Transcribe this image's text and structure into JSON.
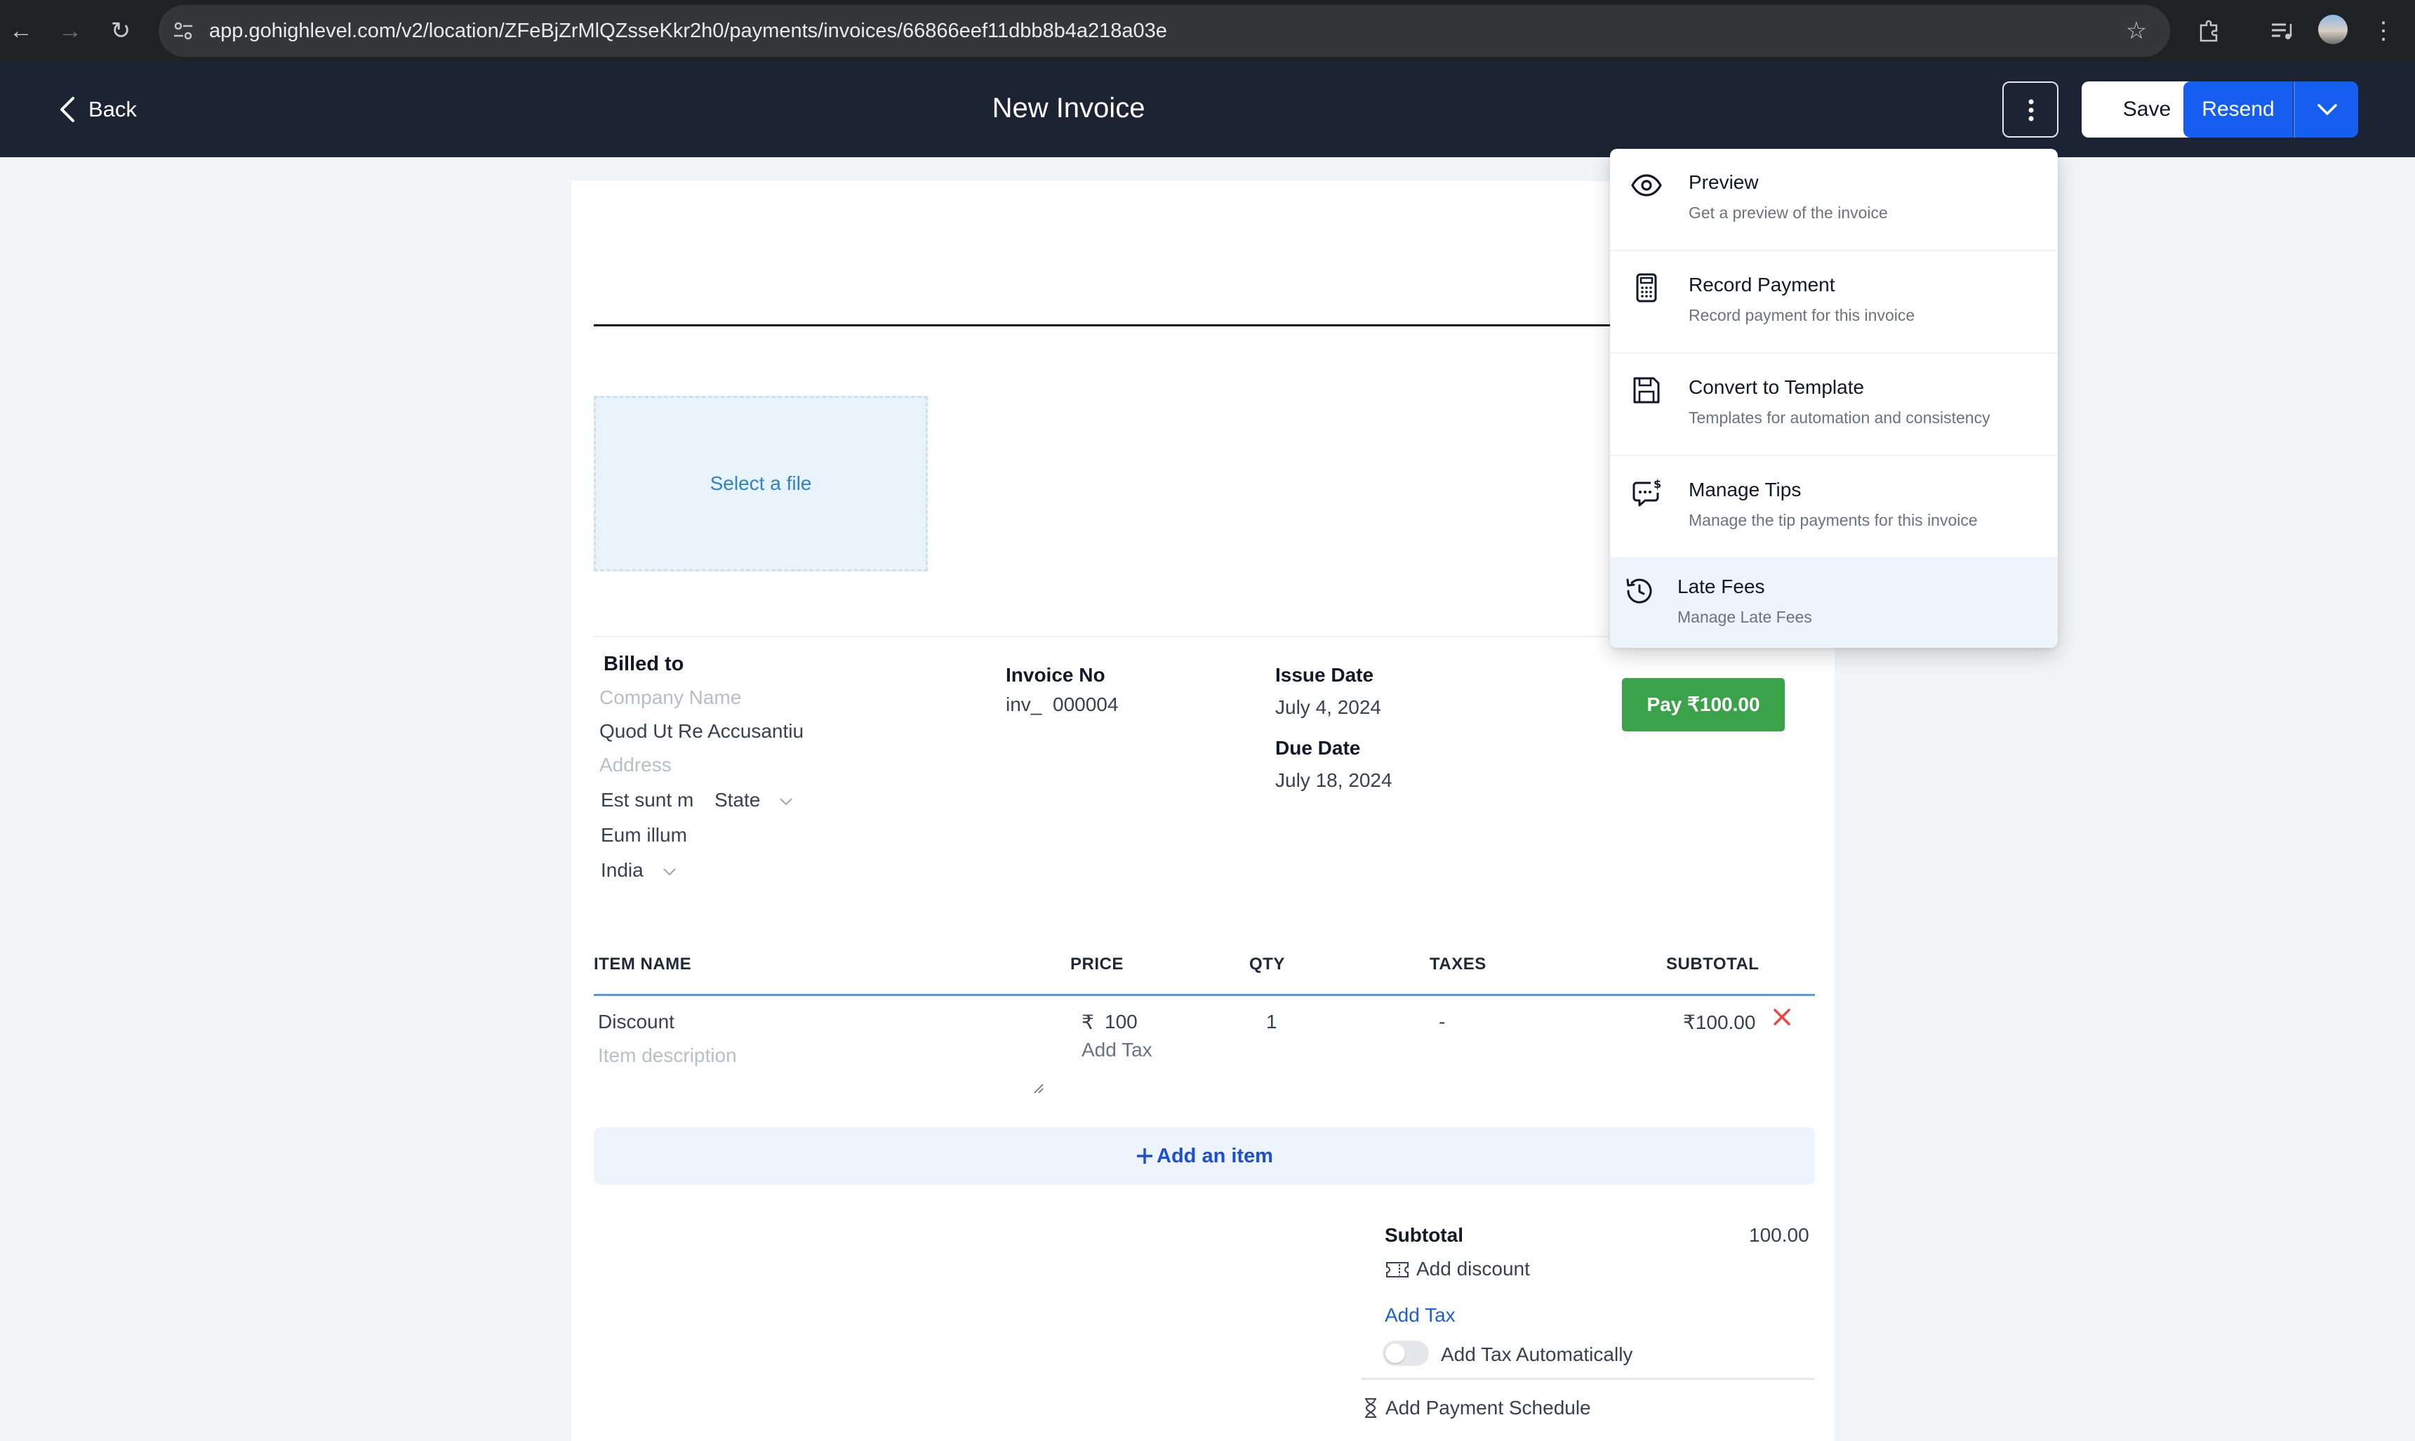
{
  "browser": {
    "url": "app.gohighlevel.com/v2/location/ZFeBjZrMlQZsseKkr2h0/payments/invoices/66866eef11dbb8b4a218a03e"
  },
  "header": {
    "back_label": "Back",
    "title": "New Invoice",
    "save_label": "Save",
    "resend_label": "Resend"
  },
  "menu": {
    "items": [
      {
        "icon": "eye-icon",
        "title": "Preview",
        "subtitle": "Get a preview of the invoice"
      },
      {
        "icon": "calculator-icon",
        "title": "Record Payment",
        "subtitle": "Record payment for this invoice"
      },
      {
        "icon": "floppy-disk-icon",
        "title": "Convert to Template",
        "subtitle": "Templates for automation and consistency"
      },
      {
        "icon": "tips-icon",
        "title": "Manage Tips",
        "subtitle": "Manage the tip payments for this invoice"
      },
      {
        "icon": "clock-history-icon",
        "title": "Late Fees",
        "subtitle": "Manage Late Fees"
      }
    ]
  },
  "logo_upload": {
    "label": "Select a file"
  },
  "billed_to": {
    "heading": "Billed to",
    "company_placeholder": "Company Name",
    "name": "Quod Ut Re Accusantiu",
    "address_placeholder": "Address",
    "city": "Est sunt m",
    "state": "State",
    "zip": "Eum illum",
    "country": "India"
  },
  "invoice": {
    "number_label": "Invoice No",
    "prefix": "inv_",
    "number": "000004",
    "issue_date_label": "Issue Date",
    "issue_date": "July 4, 2024",
    "due_date_label": "Due Date",
    "due_date": "July 18, 2024",
    "pay_button": "Pay ₹100.00"
  },
  "items_table": {
    "headers": [
      "ITEM NAME",
      "PRICE",
      "QTY",
      "TAXES",
      "SUBTOTAL"
    ],
    "rows": [
      {
        "name": "Discount",
        "description_placeholder": "Item description",
        "currency": "₹",
        "price": "100",
        "add_tax": "Add Tax",
        "qty": "1",
        "taxes": "-",
        "subtotal": "₹100.00"
      }
    ],
    "add_item": "Add an item"
  },
  "summary": {
    "subtotal_label": "Subtotal",
    "subtotal_value": "100.00",
    "add_discount": "Add discount",
    "add_tax": "Add Tax",
    "add_tax_auto": "Add Tax Automatically",
    "add_tax_auto_enabled": false,
    "add_payment_schedule": "Add Payment Schedule"
  },
  "colors": {
    "appbar": "#1c2434",
    "primary": "#155eef",
    "pay_green": "#3aa34a",
    "delete_red": "#ef4444"
  }
}
